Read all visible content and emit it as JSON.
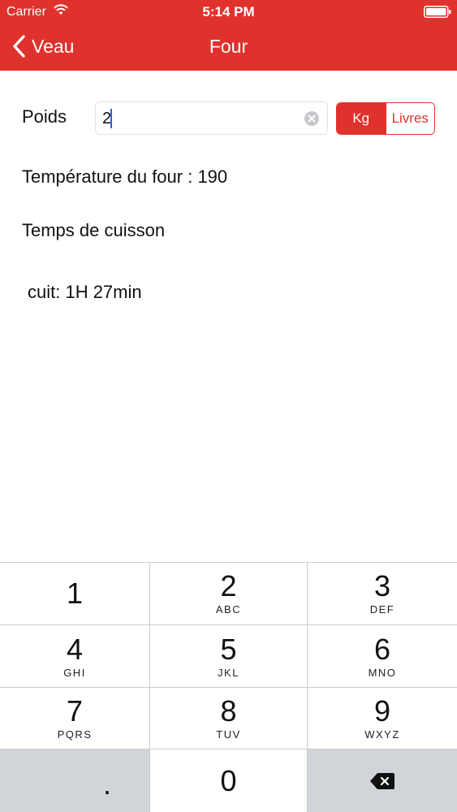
{
  "status_bar": {
    "carrier": "Carrier",
    "time": "5:14 PM",
    "icons": [
      "wifi-icon",
      "battery-icon"
    ]
  },
  "nav": {
    "back_label": "Veau",
    "back_icon": "chevron-left-icon",
    "title": "Four"
  },
  "form": {
    "weight_label": "Poids",
    "weight_value": "2",
    "clear_icon": "clear-circle-icon",
    "units": {
      "kg": "Kg",
      "livres": "Livres",
      "selected": "Kg"
    }
  },
  "results": {
    "temperature": "Température du four : 190",
    "cooking_title": "Temps de cuisson",
    "cooked": "cuit: 1H 27min"
  },
  "keypad": {
    "keys": [
      {
        "digit": "1",
        "letters": ""
      },
      {
        "digit": "2",
        "letters": "ABC"
      },
      {
        "digit": "3",
        "letters": "DEF"
      },
      {
        "digit": "4",
        "letters": "GHI"
      },
      {
        "digit": "5",
        "letters": "JKL"
      },
      {
        "digit": "6",
        "letters": "MNO"
      },
      {
        "digit": "7",
        "letters": "PQRS"
      },
      {
        "digit": "8",
        "letters": "TUV"
      },
      {
        "digit": "9",
        "letters": "WXYZ"
      }
    ],
    "decimal": ".",
    "zero": "0",
    "delete_icon": "backspace-icon"
  },
  "colors": {
    "accent": "#e0322c",
    "keypad_gray": "#d1d4d9",
    "caret": "#2c62d8"
  }
}
